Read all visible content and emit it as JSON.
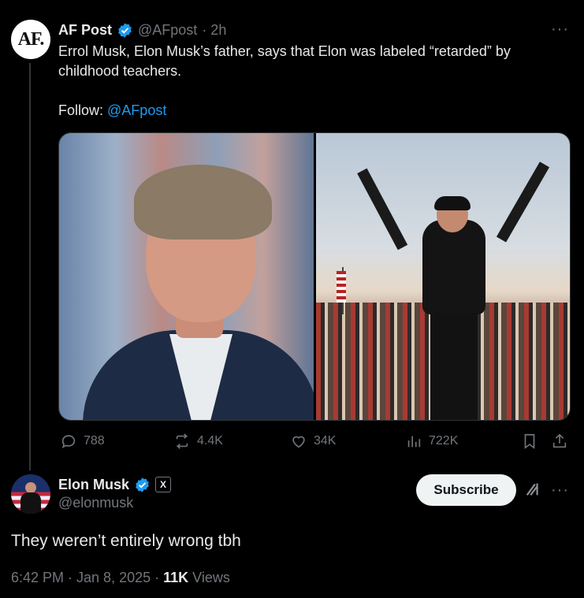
{
  "parent_tweet": {
    "author_name": "AF Post",
    "avatar_text": "AF.",
    "handle": "@AFpost",
    "time": "· 2h",
    "text_line1": "Errol Musk, Elon Musk’s father, says that Elon was labeled “retarded” by",
    "text_line2": "childhood teachers.",
    "follow_label": "Follow:",
    "follow_handle": "@AFpost",
    "actions": {
      "replies": "788",
      "reposts": "4.4K",
      "likes": "34K",
      "views": "722K"
    }
  },
  "reply_tweet": {
    "author_name": "Elon Musk",
    "handle": "@elonmusk",
    "affiliate_badge": "X",
    "subscribe_label": "Subscribe",
    "text": "They weren’t entirely wrong tbh",
    "time": "6:42 PM · Jan 8, 2025 ·",
    "views_count": "11K",
    "views_label": "Views"
  },
  "colors": {
    "background": "#000000",
    "text": "#e7e9ea",
    "muted": "#71767b",
    "accent": "#1d9bf0",
    "verified": "#1d9bf0"
  },
  "icons": [
    "more-icon",
    "verified-badge-icon",
    "reply-icon",
    "repost-icon",
    "like-icon",
    "views-icon",
    "bookmark-icon",
    "share-icon",
    "grok-icon"
  ]
}
